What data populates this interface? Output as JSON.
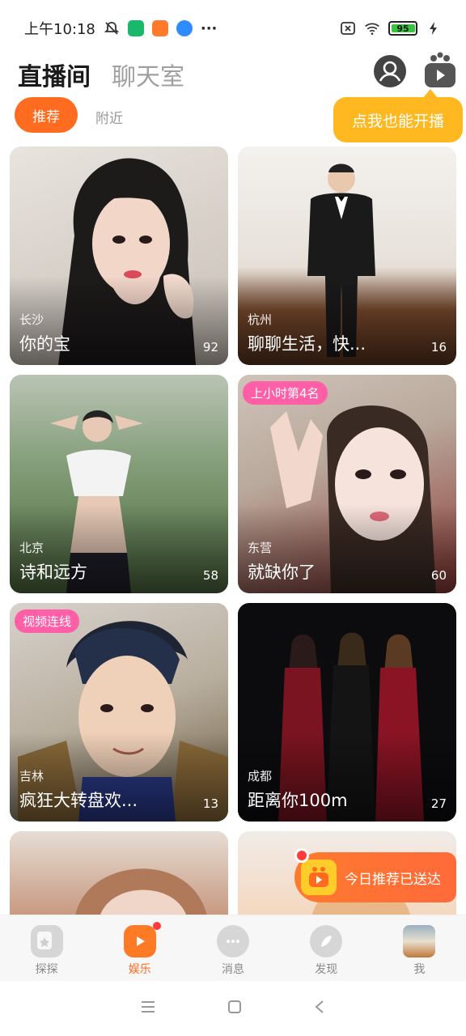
{
  "status_bar": {
    "time": "上午10:18",
    "more": "···",
    "battery": "95"
  },
  "header": {
    "tab_main": "直播间",
    "tab_chat": "聊天室"
  },
  "subtabs": {
    "active": "推荐",
    "nearby": "附近"
  },
  "tooltip": "点我也能开播",
  "cards": [
    {
      "city": "长沙",
      "title": "你的宝",
      "count": "92",
      "tag": ""
    },
    {
      "city": "杭州",
      "title": "聊聊生活，快...",
      "count": "16",
      "tag": ""
    },
    {
      "city": "北京",
      "title": "诗和远方",
      "count": "58",
      "tag": ""
    },
    {
      "city": "东营",
      "title": "就缺你了",
      "count": "60",
      "tag": "上小时第4名"
    },
    {
      "city": "吉林",
      "title": "疯狂大转盘欢...",
      "count": "13",
      "tag": "视频连线"
    },
    {
      "city": "成都",
      "title": "距离你100m",
      "count": "27",
      "tag": ""
    }
  ],
  "notice": "今日推荐已送达",
  "bottom_nav": [
    {
      "label": "探探",
      "icon": "cards-icon"
    },
    {
      "label": "娱乐",
      "icon": "live-tv-icon"
    },
    {
      "label": "消息",
      "icon": "chat-bubble-icon"
    },
    {
      "label": "发现",
      "icon": "compass-icon"
    },
    {
      "label": "我",
      "icon": "avatar"
    }
  ],
  "colors": {
    "accent": "#ff6b1f",
    "tooltip": "#ffb81f",
    "tag": "#ff5fa6"
  }
}
